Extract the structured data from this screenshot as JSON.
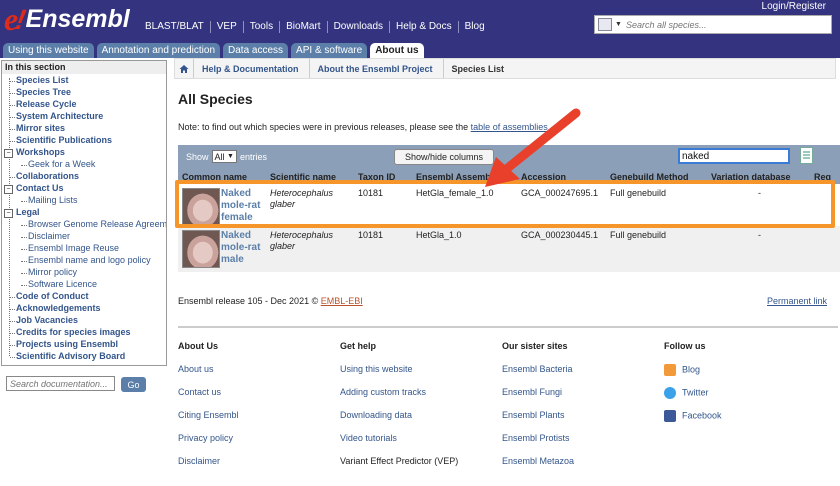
{
  "brand": {
    "logo_e": "e",
    "logo_rest": "Ensembl",
    "accent": "#33337f",
    "link": "#33558b"
  },
  "topnav": [
    "BLAST/BLAT",
    "VEP",
    "Tools",
    "BioMart",
    "Downloads",
    "Help & Docs",
    "Blog"
  ],
  "login": "Login/Register",
  "site_search": {
    "placeholder": "Search all species..."
  },
  "tabs": [
    "Using this website",
    "Annotation and prediction",
    "Data access",
    "API & software",
    "About us"
  ],
  "leftnav": {
    "heading": "In this section",
    "items": [
      {
        "label": "Species List",
        "level": 0
      },
      {
        "label": "Species Tree",
        "level": 0
      },
      {
        "label": "Release Cycle",
        "level": 0
      },
      {
        "label": "System Architecture",
        "level": 0
      },
      {
        "label": "Mirror sites",
        "level": 0
      },
      {
        "label": "Scientific Publications",
        "level": 0
      },
      {
        "label": "Workshops",
        "level": 0
      },
      {
        "label": "Geek for a Week",
        "level": 1
      },
      {
        "label": "Collaborations",
        "level": 0
      },
      {
        "label": "Contact Us",
        "level": 0
      },
      {
        "label": "Mailing Lists",
        "level": 1
      },
      {
        "label": "Legal",
        "level": 0
      },
      {
        "label": "Browser Genome Release Agreement",
        "level": 1
      },
      {
        "label": "Disclaimer",
        "level": 1
      },
      {
        "label": "Ensembl Image Reuse",
        "level": 1
      },
      {
        "label": "Ensembl name and logo policy",
        "level": 1
      },
      {
        "label": "Mirror policy",
        "level": 1
      },
      {
        "label": "Software Licence",
        "level": 1
      },
      {
        "label": "Code of Conduct",
        "level": 0
      },
      {
        "label": "Acknowledgements",
        "level": 0
      },
      {
        "label": "Job Vacancies",
        "level": 0
      },
      {
        "label": "Credits for species images",
        "level": 0
      },
      {
        "label": "Projects using Ensembl",
        "level": 0
      },
      {
        "label": "Scientific Advisory Board",
        "level": 0
      }
    ],
    "doc_search_placeholder": "Search documentation...",
    "go_label": "Go"
  },
  "breadcrumbs": [
    "Help & Documentation",
    "About the Ensembl Project",
    "Species List"
  ],
  "page_title": "All Species",
  "note": {
    "text": "Note: to find out which species were in previous releases, please see the ",
    "link": "table of assemblies"
  },
  "table_controls": {
    "show_label": "Show",
    "show_value": "All",
    "entries_label": "entries",
    "show_hide_label": "Show/hide columns",
    "filter_value": "naked"
  },
  "table": {
    "columns": [
      "Common name",
      "Scientific name",
      "Taxon ID",
      "Ensembl Assembly",
      "Accession",
      "Genebuild Method",
      "Variation database",
      "Reg"
    ],
    "rows": [
      {
        "common": "Naked mole-rat female",
        "scientific": "Heterocephalus glaber",
        "taxon": "10181",
        "assembly": "HetGla_female_1.0",
        "accession": "GCA_000247695.1",
        "method": "Full genebuild",
        "variation": "-"
      },
      {
        "common": "Naked mole-rat male",
        "scientific": "Heterocephalus glaber",
        "taxon": "10181",
        "assembly": "HetGla_1.0",
        "accession": "GCA_000230445.1",
        "method": "Full genebuild",
        "variation": "-"
      }
    ]
  },
  "release": {
    "text": "Ensembl release 105 - Dec 2021 © ",
    "org": "EMBL-EBI"
  },
  "permanent_link": "Permanent link",
  "footer": {
    "about": {
      "heading": "About Us",
      "links": [
        "About us",
        "Contact us",
        "Citing Ensembl",
        "Privacy policy",
        "Disclaimer"
      ]
    },
    "help": {
      "heading": "Get help",
      "links": [
        "Using this website",
        "Adding custom tracks",
        "Downloading data",
        "Video tutorials",
        "Variant Effect Predictor (VEP)"
      ]
    },
    "sister": {
      "heading": "Our sister sites",
      "links": [
        "Ensembl Bacteria",
        "Ensembl Fungi",
        "Ensembl Plants",
        "Ensembl Protists",
        "Ensembl Metazoa"
      ]
    },
    "follow": {
      "heading": "Follow us",
      "links": [
        "Blog",
        "Twitter",
        "Facebook"
      ]
    }
  },
  "annotation_colors": {
    "highlight_box": "#f6962a",
    "arrow": "#e8402b"
  }
}
